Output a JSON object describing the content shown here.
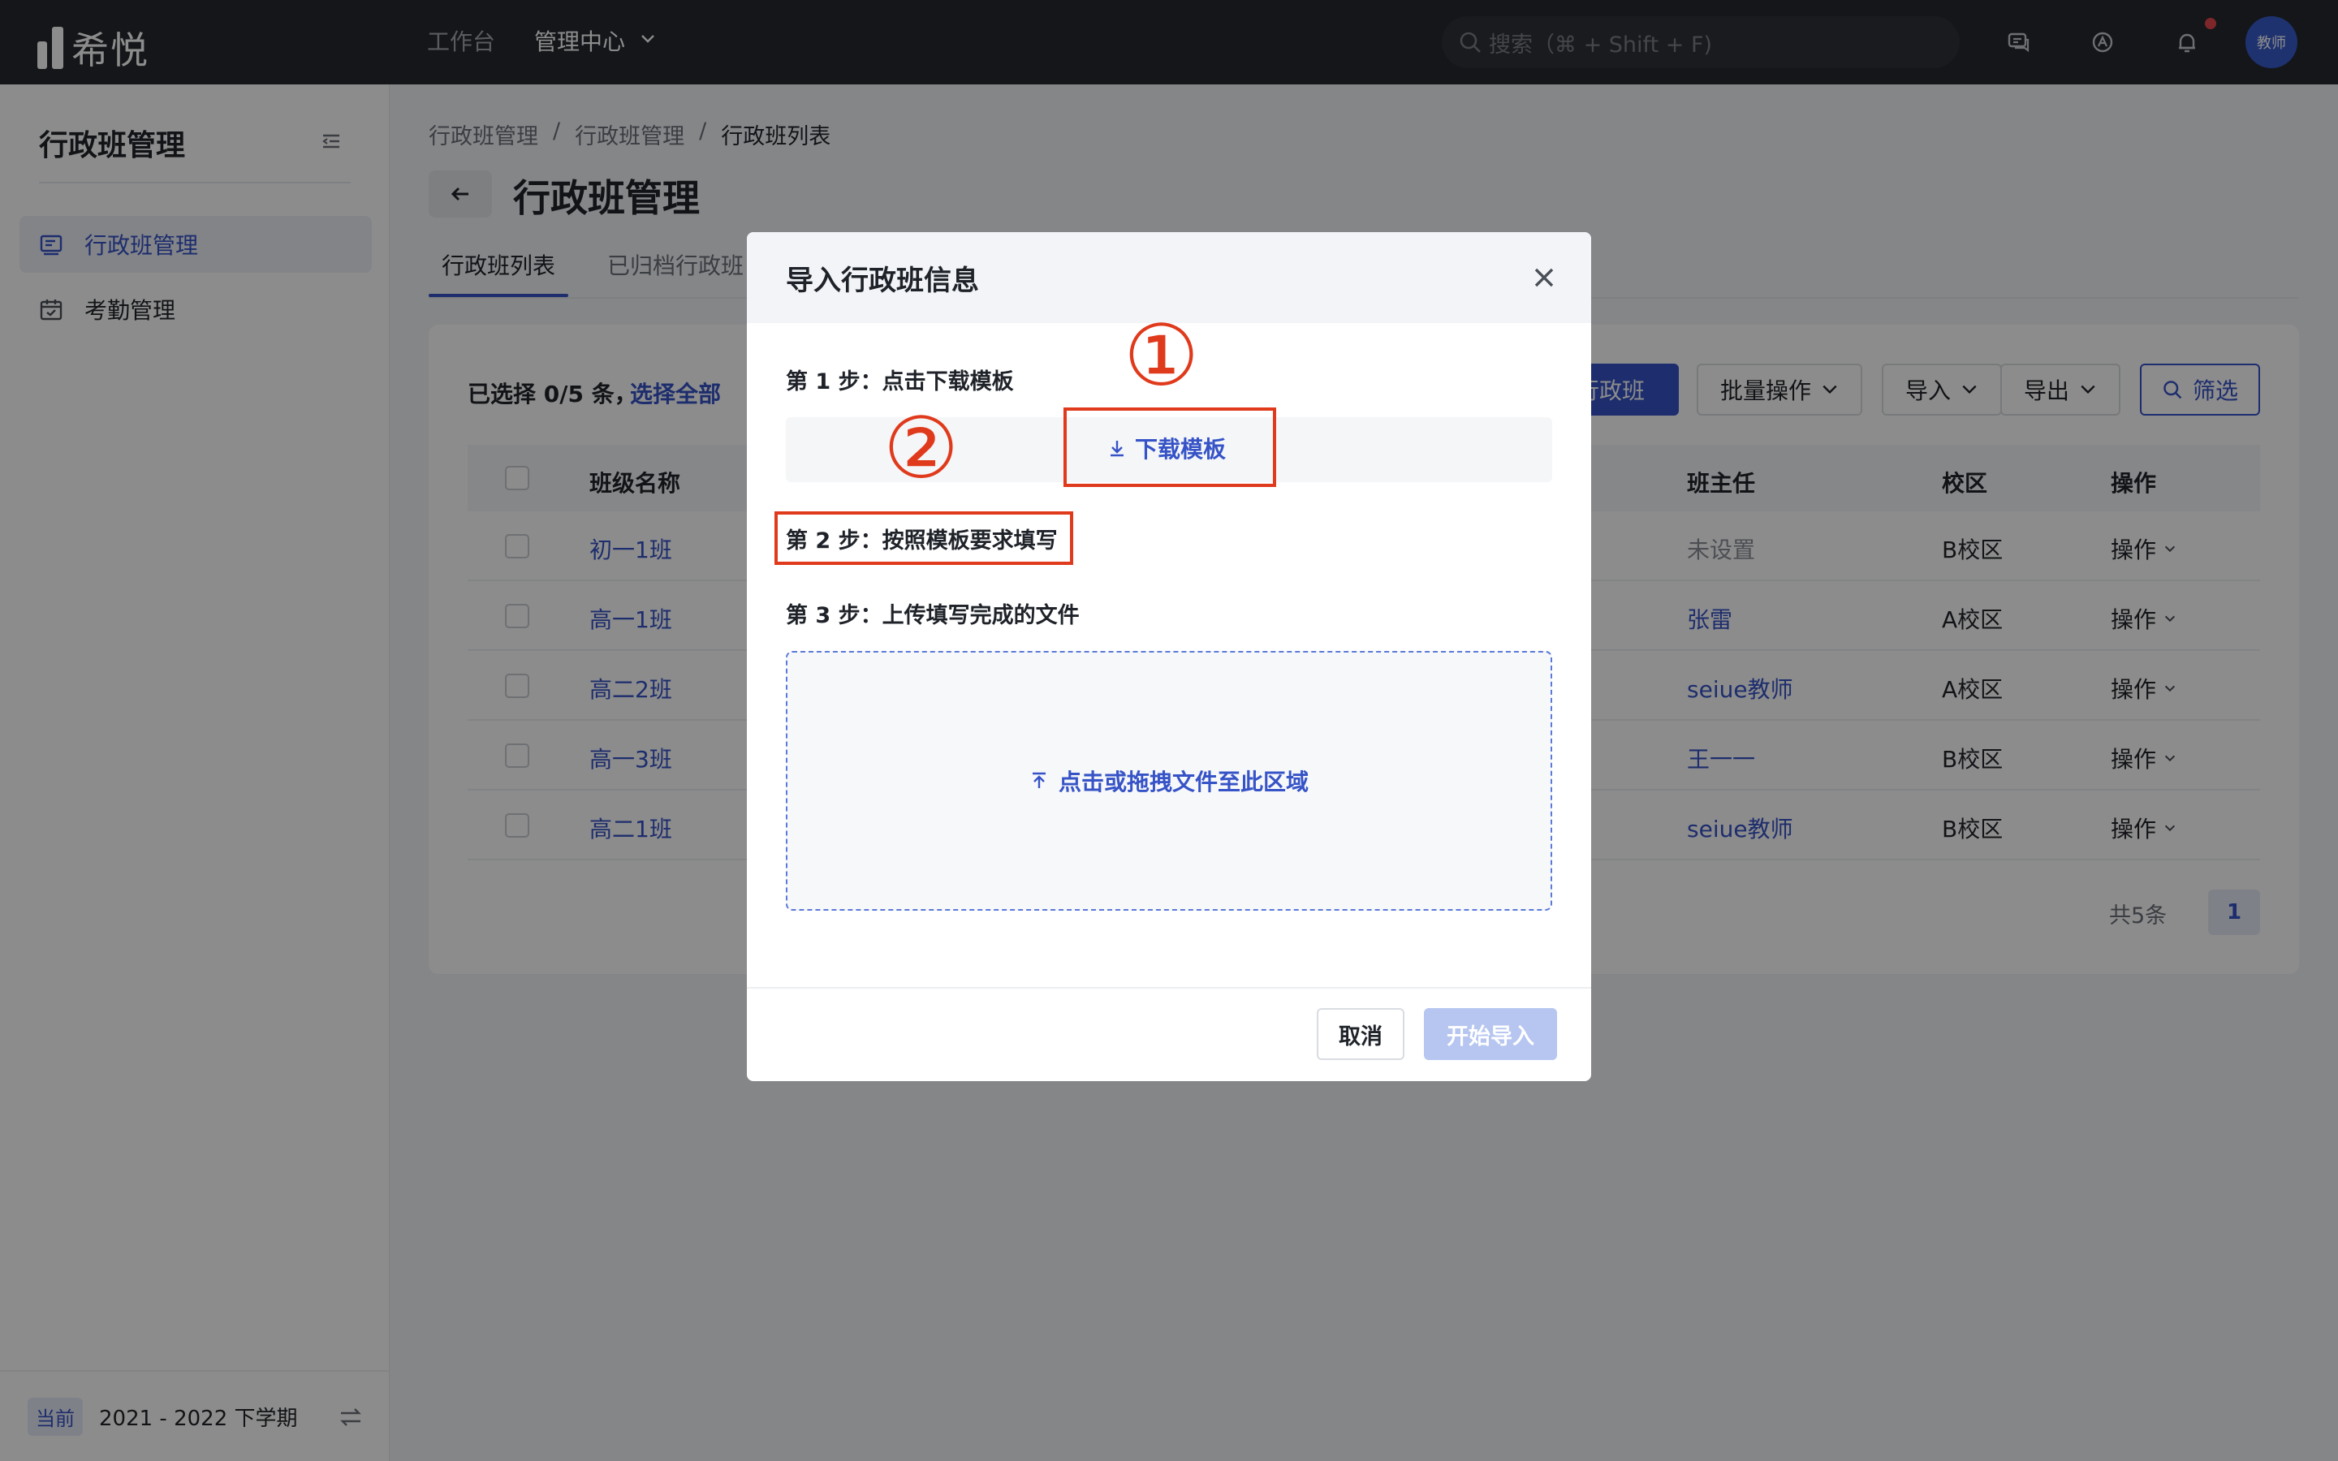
{
  "topbar": {
    "logo_text": "希悦",
    "nav": [
      {
        "label": "工作台"
      },
      {
        "label": "管理中心"
      }
    ],
    "search_placeholder": "搜索（⌘ + Shift + F)",
    "avatar_text": "教师"
  },
  "sidebar": {
    "title": "行政班管理",
    "items": [
      {
        "label": "行政班管理",
        "icon": "class-icon"
      },
      {
        "label": "考勤管理",
        "icon": "calendar-icon"
      }
    ],
    "term_badge": "当前",
    "term_label": "2021 - 2022 下学期"
  },
  "main": {
    "breadcrumb": [
      "行政班管理",
      "行政班管理",
      "行政班列表"
    ],
    "separator": "/",
    "title": "行政班管理",
    "tabs": [
      {
        "label": "行政班列表"
      },
      {
        "label": "已归档行政班"
      }
    ],
    "selection_text": "已选择 0/5 条，",
    "select_all": "选择全部",
    "toolbar": {
      "add": "行政班",
      "batch": "批量操作",
      "import": "导入",
      "export": "导出",
      "filter": "筛选"
    },
    "table": {
      "headers": [
        "班级名称",
        "班主任",
        "校区",
        "操作"
      ],
      "rows": [
        {
          "name": "初一1班",
          "teacher": "未设置",
          "campus": "B校区",
          "op": "操作"
        },
        {
          "name": "高一1班",
          "teacher": "张雷",
          "campus": "A校区",
          "op": "操作"
        },
        {
          "name": "高二2班",
          "teacher": "seiue教师",
          "campus": "A校区",
          "op": "操作"
        },
        {
          "name": "高一3班",
          "teacher": "王一一",
          "campus": "B校区",
          "op": "操作"
        },
        {
          "name": "高二1班",
          "teacher": "seiue教师",
          "campus": "B校区",
          "op": "操作"
        }
      ]
    },
    "pager": {
      "total": "共5条",
      "page": "1"
    }
  },
  "modal": {
    "title": "导入行政班信息",
    "step1": "第 1 步：点击下载模板",
    "download": "下载模板",
    "step2": "第 2 步：按照模板要求填写",
    "step3": "第 3 步：上传填写完成的文件",
    "upload_hint": "点击或拖拽文件至此区域",
    "cancel": "取消",
    "start": "开始导入"
  },
  "annotations": {
    "marker1": "①",
    "marker2": "②",
    "color": "#e03a1c"
  },
  "colors": {
    "primary": "#3653c7",
    "topbar": "#25282e"
  }
}
